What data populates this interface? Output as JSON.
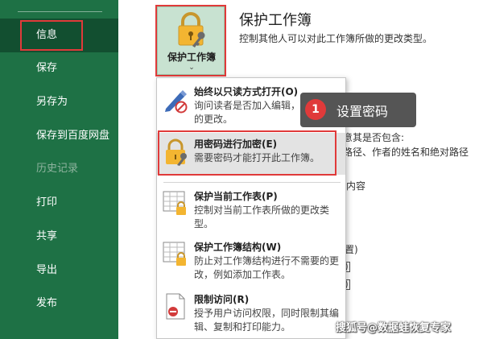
{
  "sidebar": {
    "items": [
      {
        "label": "信息"
      },
      {
        "label": "保存"
      },
      {
        "label": "另存为"
      },
      {
        "label": "保存到百度网盘"
      },
      {
        "label": "历史记录"
      },
      {
        "label": "打印"
      },
      {
        "label": "共享"
      },
      {
        "label": "导出"
      },
      {
        "label": "发布"
      }
    ]
  },
  "protect": {
    "button_label": "保护工作簿",
    "title": "保护工作簿",
    "description": "控制其他人可以对此工作簿所做的更改类型。"
  },
  "background": {
    "line1": "意其是否包含:",
    "line2": "路径、作者的姓名和绝对路径",
    "line3": "内容",
    "box1": "置)",
    "box2": ")",
    "box3": ")"
  },
  "menu": {
    "items": [
      {
        "title": "始终以只读方式打开(O)",
        "desc": "询问读者是否加入编辑，以防意外的更改。"
      },
      {
        "title": "用密码进行加密(E)",
        "desc": "需要密码才能打开此工作簿。"
      },
      {
        "title": "保护当前工作表(P)",
        "desc": "控制对当前工作表所做的更改类型。"
      },
      {
        "title": "保护工作簿结构(W)",
        "desc": "防止对工作簿结构进行不需要的更改，例如添加工作表。"
      },
      {
        "title": "限制访问(R)",
        "desc": "授予用户访问权限，同时限制其编辑、复制和打印能力。"
      }
    ]
  },
  "callout": {
    "number": "1",
    "text": "设置密码"
  },
  "watermark": "搜狐号@数据蛙恢复专家",
  "colors": {
    "sidebar": "#1e7145",
    "sidebar_active": "#124f30",
    "highlight": "#e03a3a",
    "button_bg": "#c8e2d1"
  }
}
